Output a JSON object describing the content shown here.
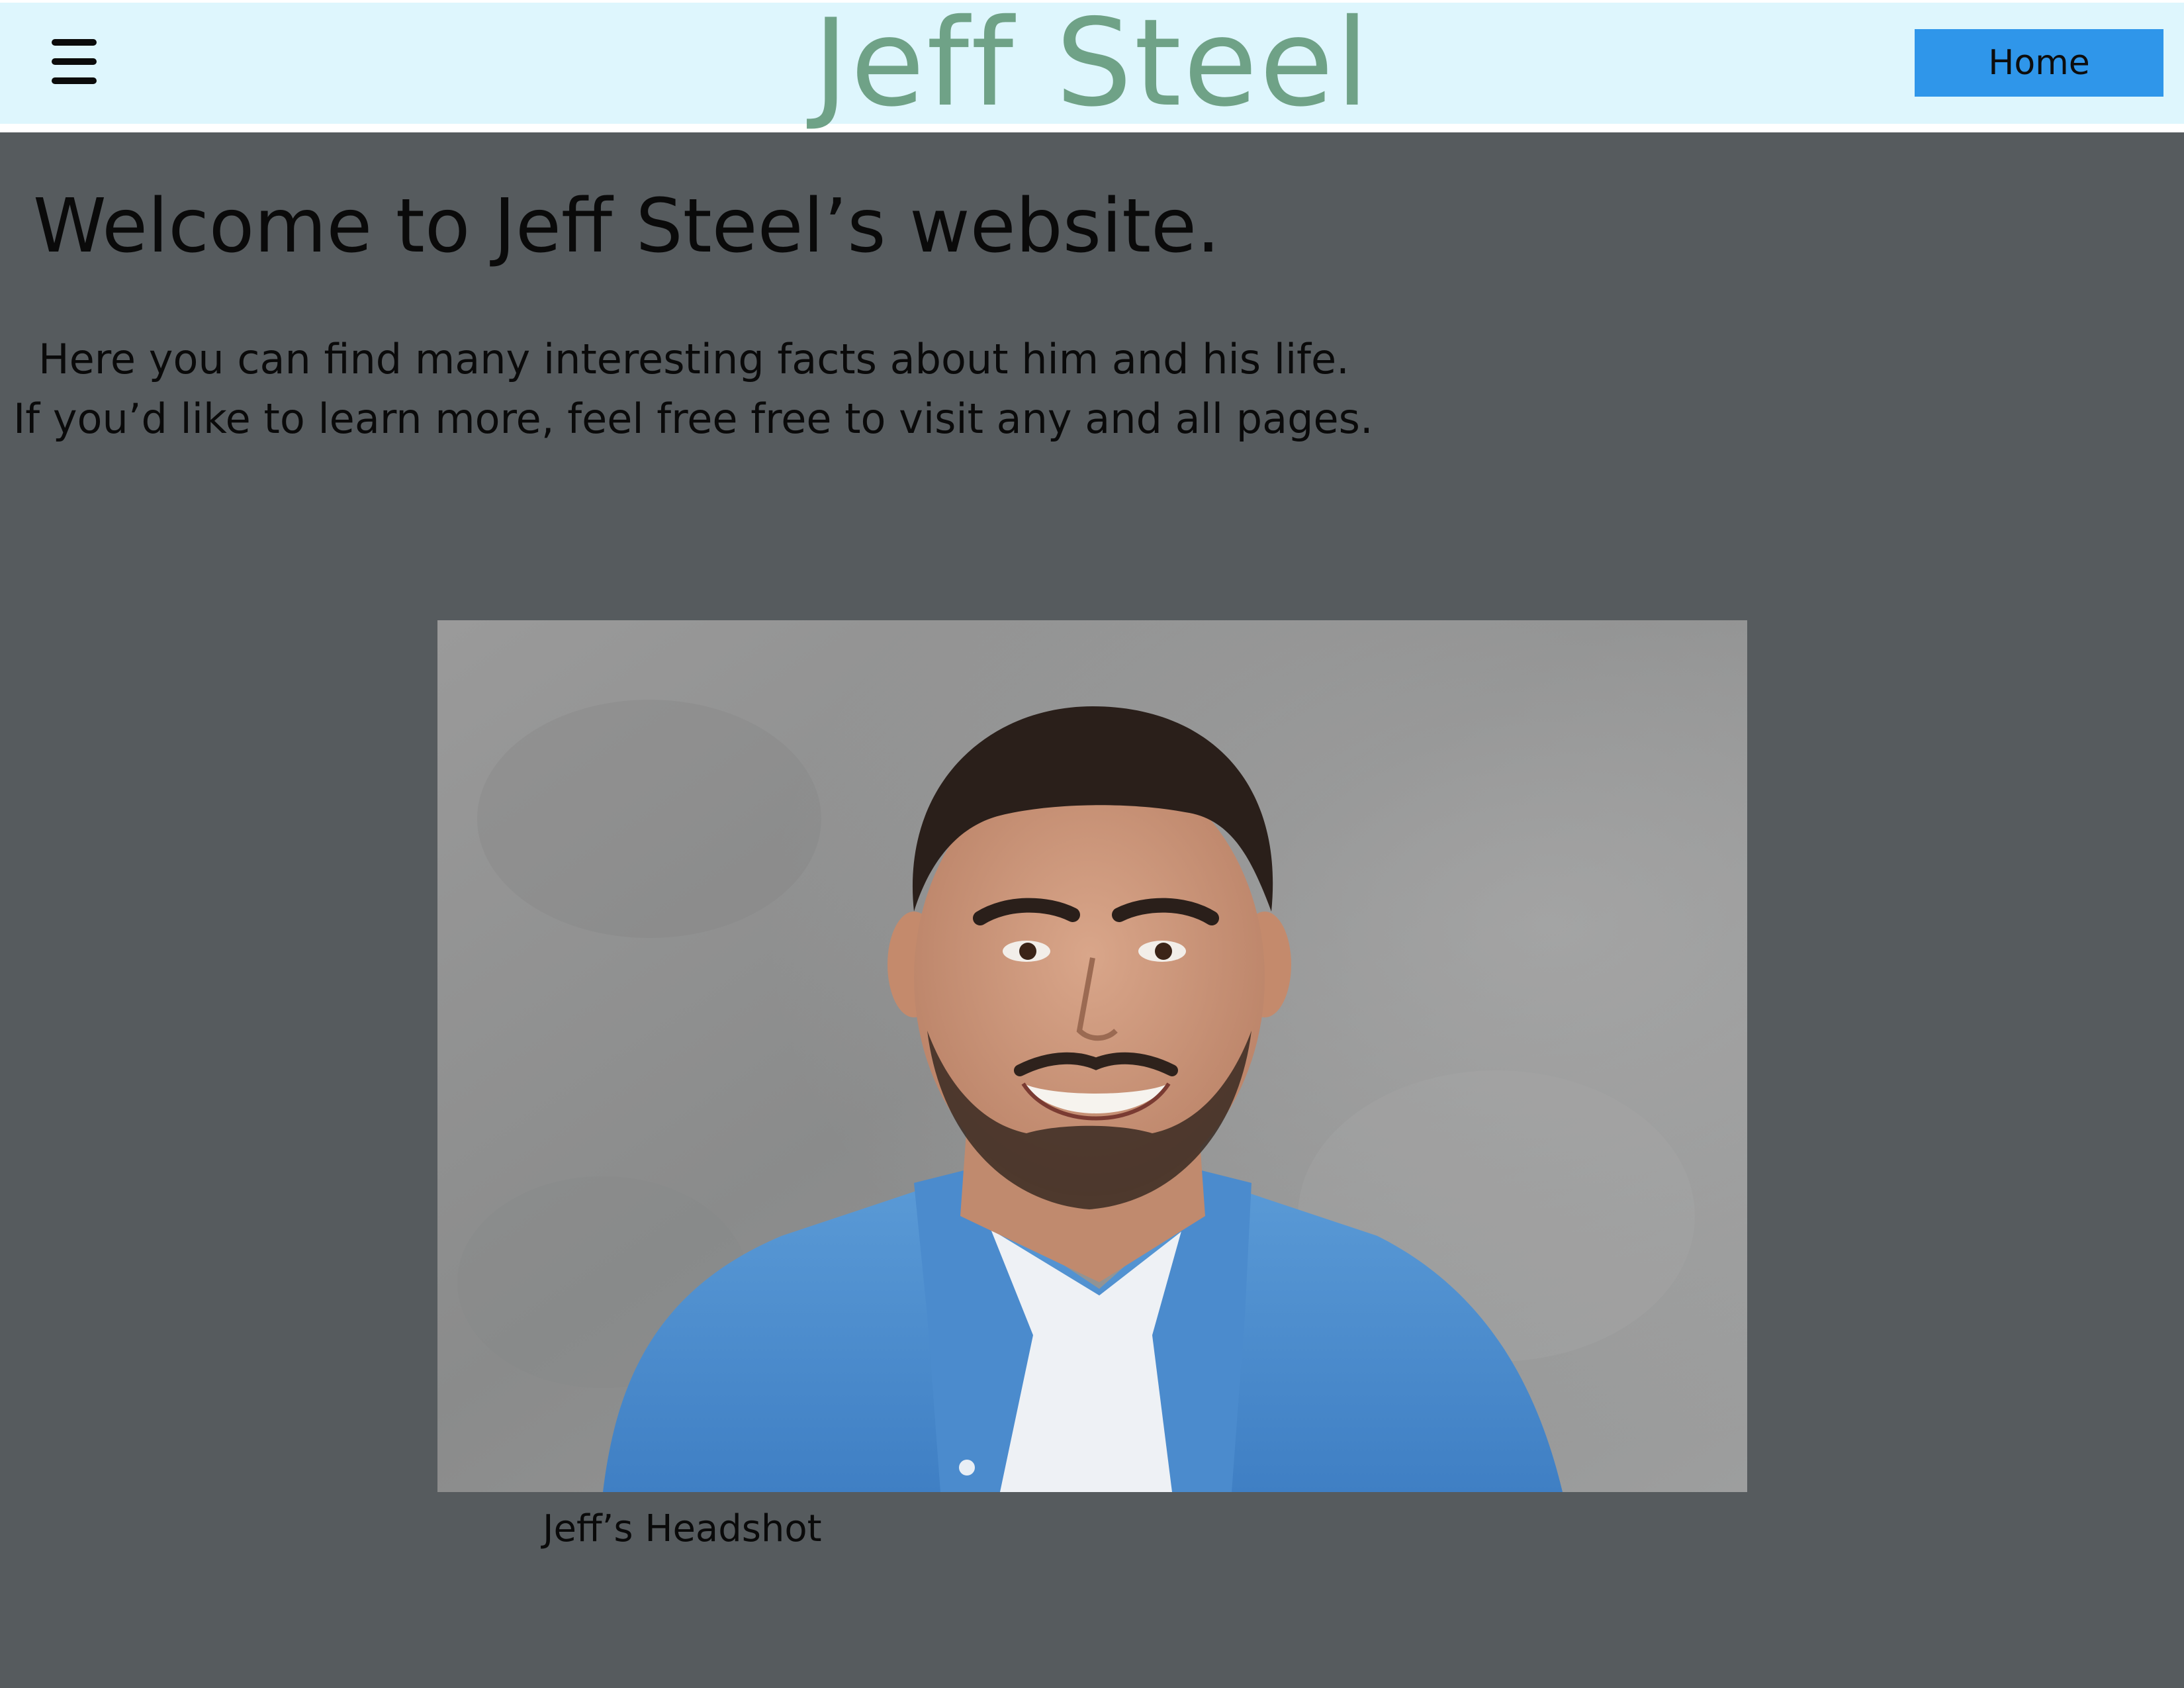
{
  "header": {
    "site_title": "Jeff Steel",
    "home_label": "Home",
    "menu_icon": "hamburger-menu-icon"
  },
  "main": {
    "heading": "Welcome to Jeff Steel’s website.",
    "intro_lines": [
      "Here you can find many interesting facts about him and his life.",
      "If you’d like to learn more, feel free free to visit any and all pages."
    ],
    "photo_caption": "Jeff’s Headshot"
  },
  "colors": {
    "header_background": "#def6fd",
    "title_color": "#6fa287",
    "home_button": "#2f96ea",
    "page_background": "#565b5e"
  }
}
